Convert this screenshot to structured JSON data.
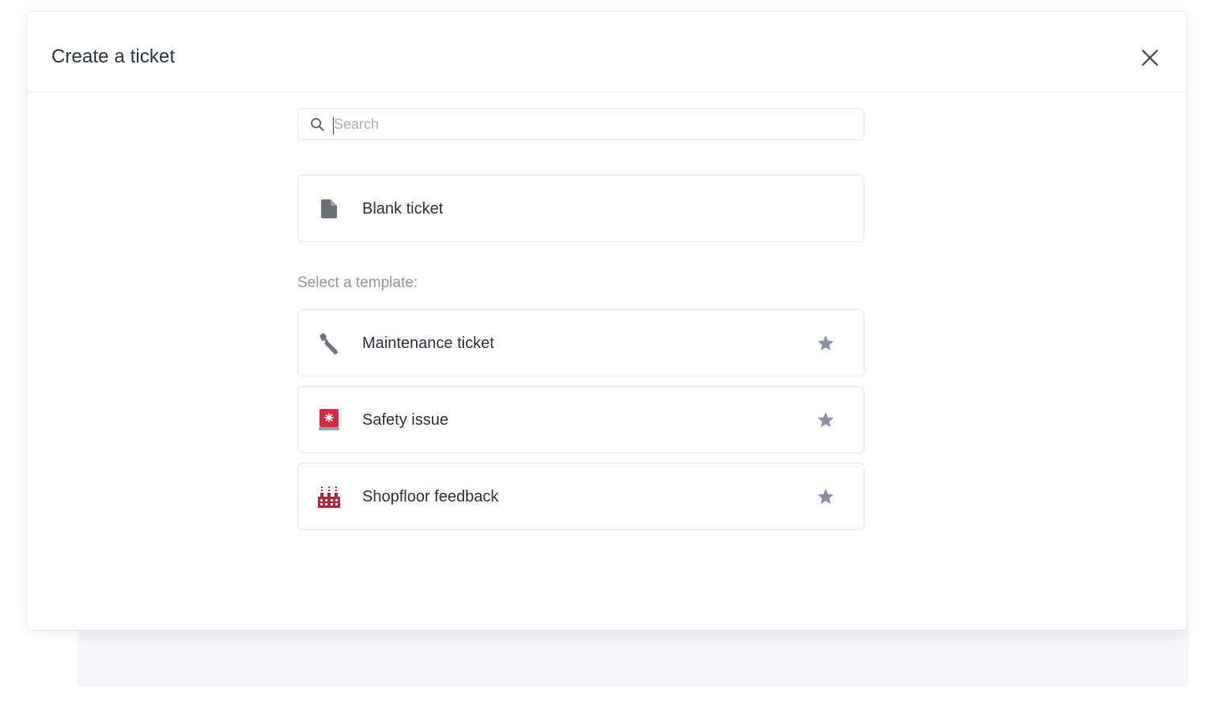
{
  "modal": {
    "title": "Create a ticket",
    "close_icon": "close-icon"
  },
  "search": {
    "placeholder": "Search",
    "value": "",
    "icon": "search-icon"
  },
  "blank_ticket": {
    "label": "Blank ticket",
    "icon": "document-icon"
  },
  "templates": {
    "section_label": "Select a template:",
    "items": [
      {
        "label": "Maintenance ticket",
        "icon": "wrench-icon",
        "favorite_icon": "star-icon"
      },
      {
        "label": "Safety issue",
        "icon": "siren-icon",
        "favorite_icon": "star-icon"
      },
      {
        "label": "Shopfloor feedback",
        "icon": "factory-icon",
        "favorite_icon": "star-icon"
      }
    ]
  },
  "colors": {
    "text_primary": "#2b3442",
    "text_muted": "#8b95a3",
    "icon_gray": "#6b7280",
    "star_gray": "#8793a4",
    "alert_red": "#d8283f",
    "factory_red": "#b8233a",
    "border": "#e0e3e9"
  }
}
